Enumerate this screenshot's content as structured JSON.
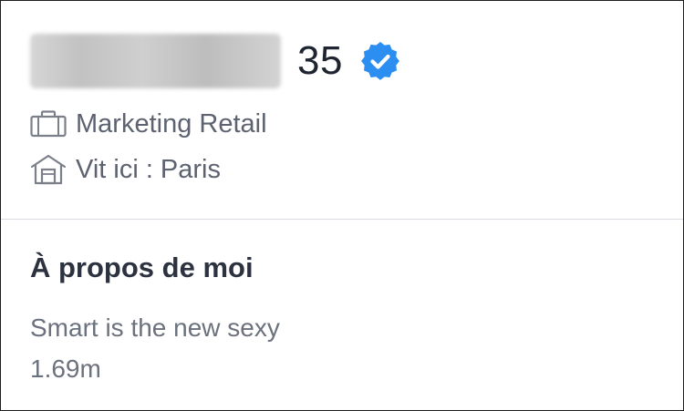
{
  "profile": {
    "age": "35",
    "job": "Marketing Retail",
    "city": "Vit ici : Paris"
  },
  "about": {
    "title": "À propos de moi",
    "bio_lines": [
      "Smart is the new sexy",
      "1.69m"
    ]
  },
  "icons": {
    "verified": "verified-badge-icon",
    "job": "briefcase-icon",
    "city": "home-icon"
  },
  "colors": {
    "verified_blue": "#2b8ef0",
    "text_dark": "#1e2430",
    "text_muted": "#5c6270"
  }
}
